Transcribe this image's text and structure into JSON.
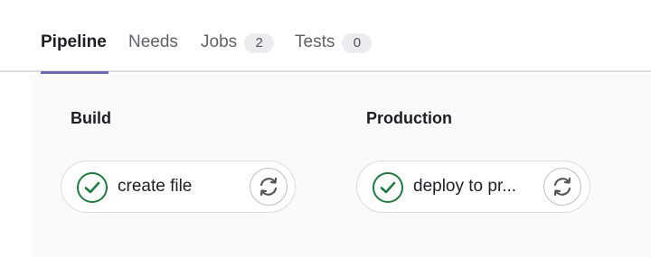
{
  "tabs": [
    {
      "label": "Pipeline",
      "active": true
    },
    {
      "label": "Needs",
      "active": false
    },
    {
      "label": "Jobs",
      "badge": "2",
      "active": false
    },
    {
      "label": "Tests",
      "badge": "0",
      "active": false
    }
  ],
  "stages": [
    {
      "title": "Build",
      "jobs": [
        {
          "name": "create file",
          "status": "success",
          "status_icon": "check-circle-icon",
          "action_icon": "retry-icon"
        }
      ]
    },
    {
      "title": "Production",
      "jobs": [
        {
          "name": "deploy to pr...",
          "status": "success",
          "status_icon": "check-circle-icon",
          "action_icon": "retry-icon"
        }
      ]
    }
  ],
  "colors": {
    "success": "#1f7a3f",
    "active_tab_underline": "#6e6ab0",
    "graph_background": "#fafafa"
  }
}
